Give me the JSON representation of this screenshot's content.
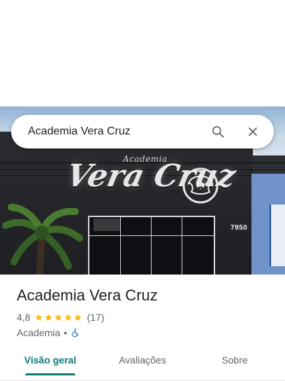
{
  "search": {
    "query": "Academia Vera Cruz",
    "search_icon": "search-icon",
    "close_icon": "close-icon"
  },
  "hero": {
    "signage_small": "Academia",
    "signage_main": "Vera Cruz",
    "building_number": "7950",
    "image_subject": "facade-photo"
  },
  "place": {
    "title": "Academia Vera Cruz",
    "rating": "4,8",
    "stars": 5,
    "review_count": "(17)",
    "category": "Academia",
    "separator": "•",
    "accessibility_icon": "wheelchair-icon"
  },
  "tabs": [
    {
      "label": "Visão geral",
      "active": true
    },
    {
      "label": "Avaliações",
      "active": false
    },
    {
      "label": "Sobre",
      "active": false
    }
  ],
  "colors": {
    "accent": "#0b7a75",
    "star": "#fbbc04",
    "accessibility": "#1a73e8",
    "text_primary": "#202124",
    "text_secondary": "#5f6368"
  }
}
